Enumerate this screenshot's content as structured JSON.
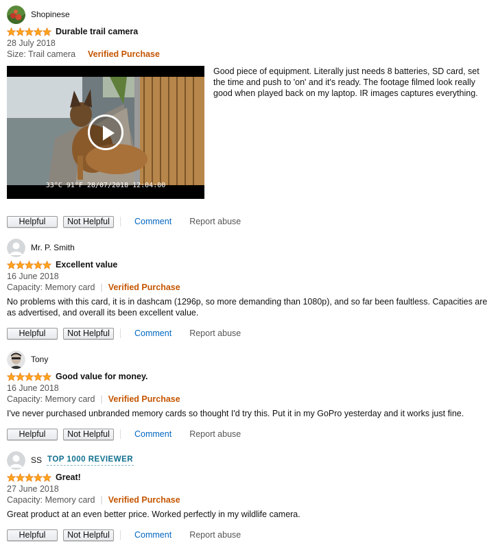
{
  "common": {
    "helpful_label": "Helpful",
    "not_helpful_label": "Not Helpful",
    "comment_label": "Comment",
    "report_label": "Report abuse",
    "verified_label": "Verified Purchase",
    "star_color": "#FFA41C",
    "verified_color": "#C45500",
    "link_color": "#0066C0",
    "star_rating": 5
  },
  "reviews": [
    {
      "name": "Shopinese",
      "avatar": "photo-avatar",
      "title": "Durable trail camera",
      "date": "28 July 2018",
      "variant": "Size: Trail camera",
      "text": " Good piece of equipment. Literally just needs 8 batteries, SD card, set the time and push to 'on' and it's ready. The footage filmed look really good when played back on my laptop. IR images captures everything.",
      "video_overlay": "33°C   91°F  28/07/2018  12:04:00"
    },
    {
      "name": "Mr. P. Smith",
      "avatar": "default-avatar",
      "title": "Excellent value",
      "date": "16 June 2018",
      "variant": "Capacity: Memory card",
      "text": "No problems with this card, it is in dashcam (1296p, so more demanding than 1080p), and so far been faultless. Capacities are as advertised, and overall its been excellent value."
    },
    {
      "name": "Tony",
      "avatar": "photo-avatar",
      "title": "Good value for money.",
      "date": "16 June 2018",
      "variant": "Capacity: Memory card",
      "text": "I've never purchased unbranded memory cards so thought I'd try this. Put it in my GoPro yesterday and it works just fine."
    },
    {
      "name": "SS",
      "avatar": "default-avatar",
      "badge": "TOP 1000 REVIEWER",
      "title": "Great!",
      "date": "27 June 2018",
      "variant": "Capacity: Memory card",
      "text": "Great product at an even better price. Worked perfectly in my wildlife camera."
    }
  ]
}
